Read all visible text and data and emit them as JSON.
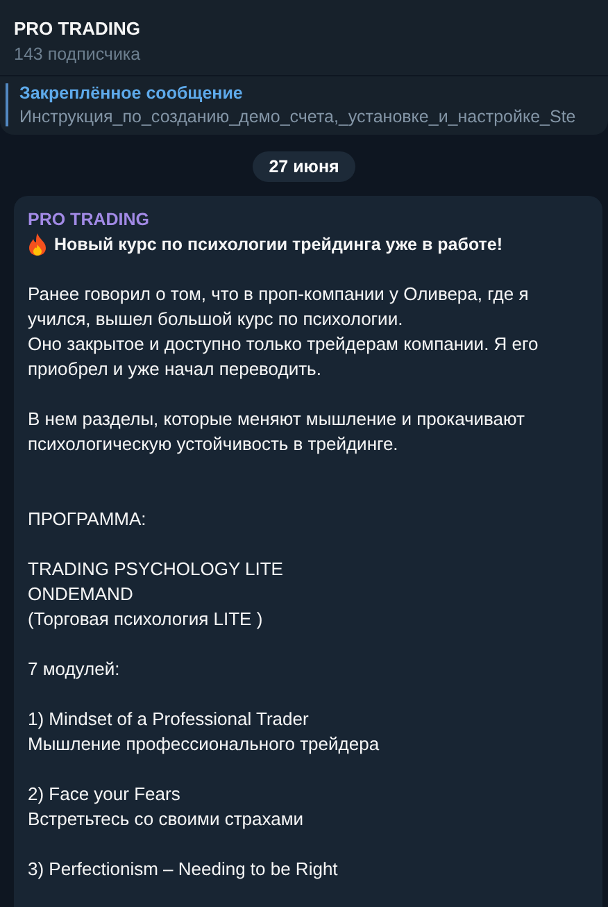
{
  "header": {
    "title": "PRO TRADING",
    "subtitle": "143 подписчика"
  },
  "pinned": {
    "label": "Закреплённое сообщение",
    "text": "Инструкция_по_созданию_демо_счета,_установке_и_настройке_Ste"
  },
  "date_badge": "27 июня",
  "message": {
    "author": "PRO TRADING",
    "title": "Новый курс по психологии трейдинга уже в работе!",
    "paragraphs": [
      "Ранее говорил о том, что в проп-компании у Оливера, где я учился, вышел большой курс по психологии.\nОно закрытое и доступно только трейдерам компании. Я его приобрел и уже начал переводить.",
      "В нем разделы, которые меняют мышление и прокачивают психологическую устойчивость в трейдинге.",
      "ПРОГРАММА:",
      "TRADING PSYCHOLOGY LITE\nONDEMAND\n(Торговая психология LITE )",
      "7 модулей:",
      "1) Mindset of a Professional Trader\nМышление профессионального трейдера",
      "2) Face your Fears\nВстретьтесь со своими страхами",
      "3) Perfectionism – Needing to be Right"
    ]
  }
}
